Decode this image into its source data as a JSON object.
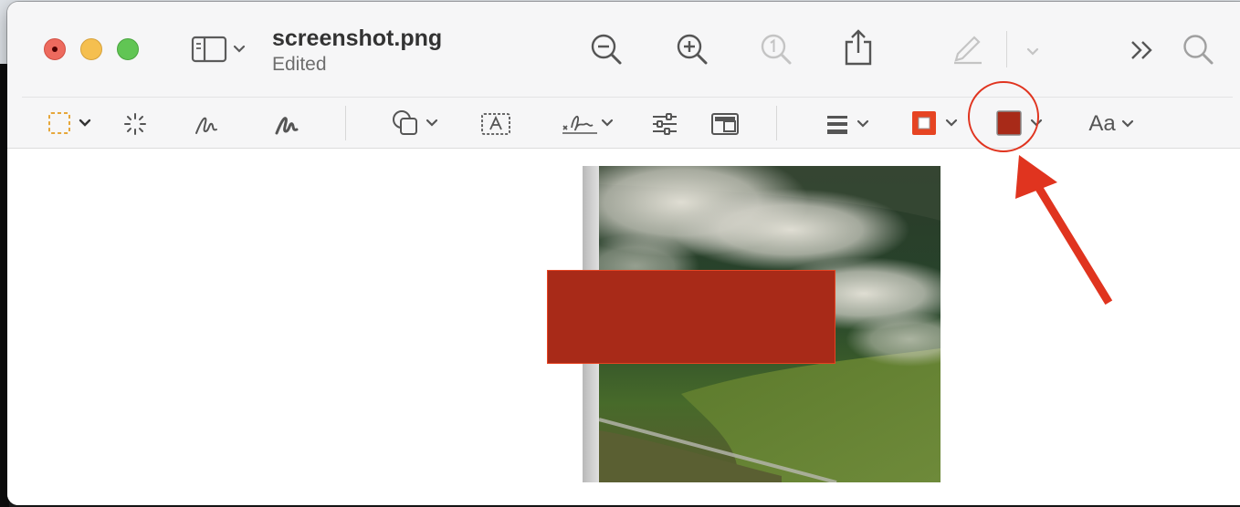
{
  "window": {
    "title": "screenshot.png",
    "subtitle": "Edited"
  },
  "toolbar": {
    "top": [
      {
        "icon": "sidebar-toggle-icon"
      },
      {
        "icon": "zoom-out-icon"
      },
      {
        "icon": "zoom-in-icon"
      },
      {
        "icon": "actual-size-icon",
        "enabled": false
      },
      {
        "icon": "share-icon"
      },
      {
        "icon": "markup-pen-icon",
        "enabled": false
      },
      {
        "icon": "more-chevrons-icon"
      },
      {
        "icon": "search-icon"
      }
    ],
    "markup": [
      {
        "icon": "rectangular-selection-icon"
      },
      {
        "icon": "instant-alpha-icon"
      },
      {
        "icon": "sketch-icon"
      },
      {
        "icon": "draw-icon"
      },
      {
        "icon": "shapes-icon"
      },
      {
        "icon": "text-box-icon"
      },
      {
        "icon": "signature-icon"
      },
      {
        "icon": "adjust-color-icon"
      },
      {
        "icon": "page-layout-icon"
      },
      {
        "icon": "shape-style-icon"
      },
      {
        "icon": "border-color-icon"
      },
      {
        "icon": "fill-color-icon"
      },
      {
        "icon": "text-style-icon"
      }
    ],
    "text_style_label": "Aa"
  },
  "colors": {
    "border_color": "#e64422",
    "fill_color": "#a82a18",
    "highlight": "#e0341f"
  },
  "canvas": {
    "image": "aerial-landscape-with-fog",
    "annotation": {
      "shape": "rectangle",
      "fill": "#a82a18",
      "border": "#e64422"
    }
  }
}
